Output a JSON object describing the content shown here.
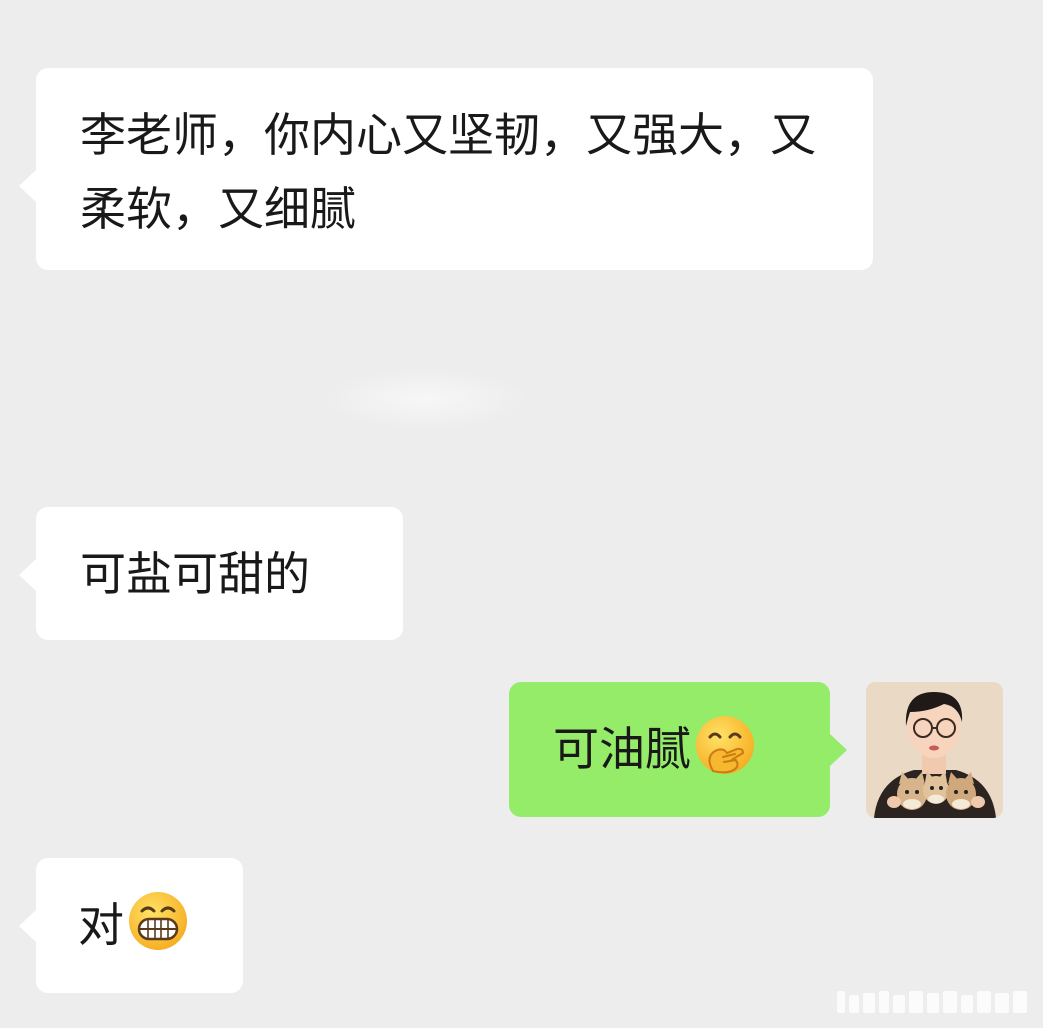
{
  "messages": [
    {
      "direction": "incoming",
      "text": "李老师，你内心又坚韧，又强大，又柔软，又细腻"
    },
    {
      "direction": "incoming",
      "text": "可盐可甜的"
    },
    {
      "direction": "outgoing",
      "text": "可油腻",
      "emoji": "hand-over-mouth-emoji"
    },
    {
      "direction": "incoming",
      "text": "对",
      "emoji": "grinning-face-emoji"
    }
  ],
  "avatar": {
    "icon": "user-avatar-woman-with-kittens"
  },
  "colors": {
    "background": "#ededed",
    "incoming_bubble": "#ffffff",
    "outgoing_bubble": "#95ec69",
    "text": "#191919"
  }
}
